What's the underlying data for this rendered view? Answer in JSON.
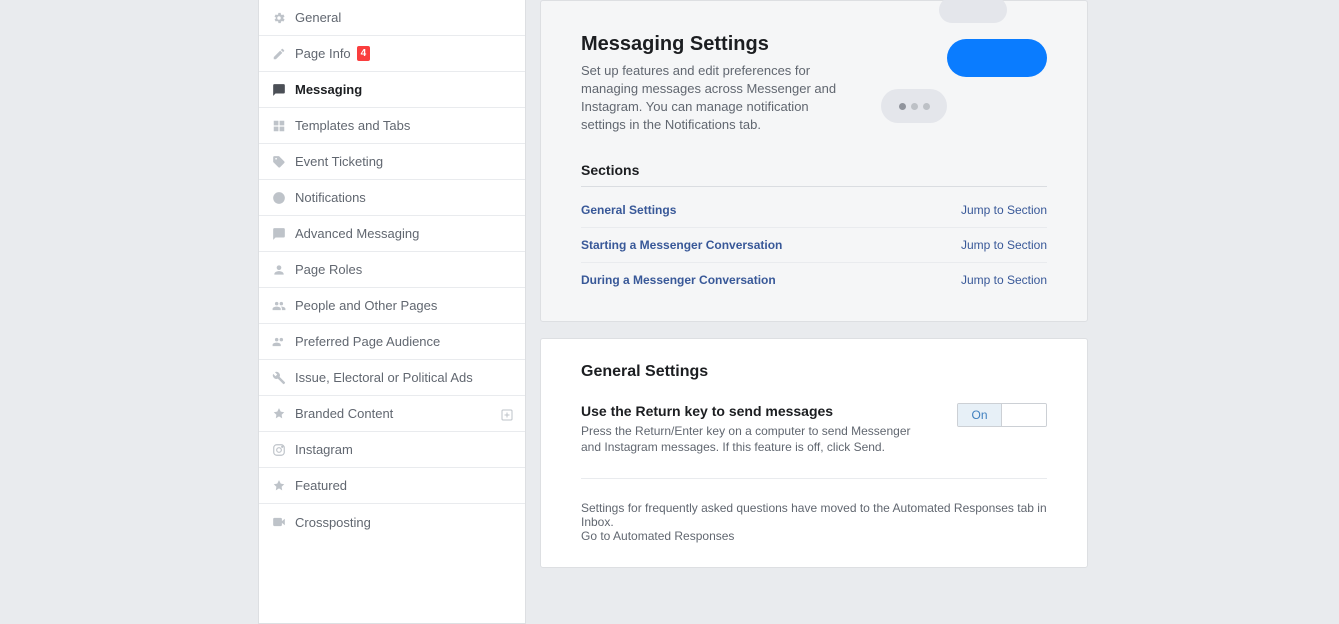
{
  "sidebar": {
    "items": [
      {
        "label": "General",
        "icon": "gear"
      },
      {
        "label": "Page Info",
        "icon": "pencil",
        "badge": "4"
      },
      {
        "label": "Messaging",
        "icon": "chat",
        "active": true
      },
      {
        "label": "Templates and Tabs",
        "icon": "grid"
      },
      {
        "label": "Event Ticketing",
        "icon": "tag"
      },
      {
        "label": "Notifications",
        "icon": "globe"
      },
      {
        "label": "Advanced Messaging",
        "icon": "chat"
      },
      {
        "label": "Page Roles",
        "icon": "person"
      },
      {
        "label": "People and Other Pages",
        "icon": "people"
      },
      {
        "label": "Preferred Page Audience",
        "icon": "people"
      },
      {
        "label": "Issue, Electoral or Political Ads",
        "icon": "wrench"
      },
      {
        "label": "Branded Content",
        "icon": "handshake",
        "addable": true
      },
      {
        "label": "Instagram",
        "icon": "instagram"
      },
      {
        "label": "Featured",
        "icon": "star"
      },
      {
        "label": "Crossposting",
        "icon": "camera"
      }
    ]
  },
  "header": {
    "title": "Messaging Settings",
    "description": "Set up features and edit preferences for managing messages across Messenger and Instagram. You can manage notification settings in the Notifications tab."
  },
  "sections": {
    "heading": "Sections",
    "jump_label": "Jump to Section",
    "rows": [
      {
        "name": "General Settings"
      },
      {
        "name": "Starting a Messenger Conversation"
      },
      {
        "name": "During a Messenger Conversation"
      }
    ]
  },
  "general": {
    "heading": "General Settings",
    "return_key": {
      "label": "Use the Return key to send messages",
      "desc": "Press the Return/Enter key on a computer to send Messenger and Instagram messages. If this feature is off, click Send.",
      "toggle_on": "On",
      "toggle_off": ""
    },
    "faq_note": "Settings for frequently asked questions have moved to the Automated Responses tab in Inbox.",
    "faq_link": "Go to Automated Responses"
  }
}
